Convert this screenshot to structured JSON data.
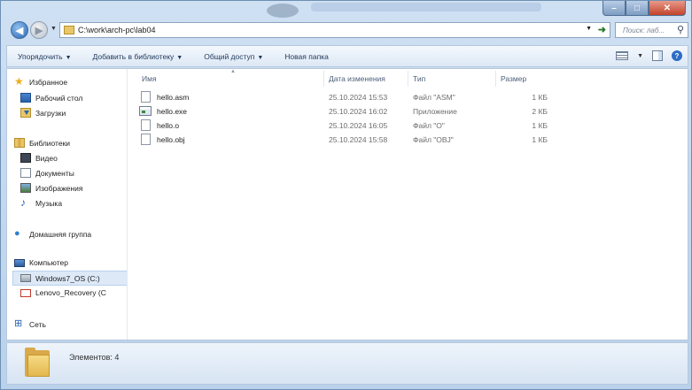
{
  "window": {
    "buttons": {
      "minimize": "–",
      "maximize": "□",
      "close": "✕"
    }
  },
  "address": {
    "path": "C:\\work\\arch-pc\\lab04",
    "search_placeholder": "Поиск: лаб..."
  },
  "toolbar": {
    "organize": "Упорядочить",
    "add_to_library": "Добавить в библиотеку",
    "share": "Общий доступ",
    "new_folder": "Новая папка"
  },
  "nav": {
    "favorites": "Избранное",
    "desktop": "Рабочий стол",
    "downloads": "Загрузки",
    "libraries": "Библиотеки",
    "video": "Видео",
    "documents": "Документы",
    "pictures": "Изображения",
    "music": "Музыка",
    "homegroup": "Домашняя группа",
    "computer": "Компьютер",
    "drive_c": "Windows7_OS (C:)",
    "drive_recovery": "Lenovo_Recovery (C",
    "network": "Сеть"
  },
  "columns": {
    "name": "Имя",
    "date": "Дата изменения",
    "type": "Тип",
    "size": "Размер"
  },
  "files": [
    {
      "name": "hello.asm",
      "date": "25.10.2024 15:53",
      "type": "Файл \"ASM\"",
      "size": "1 КБ",
      "icon": "document-icon"
    },
    {
      "name": "hello.exe",
      "date": "25.10.2024 16:02",
      "type": "Приложение",
      "size": "2 КБ",
      "icon": "application-icon"
    },
    {
      "name": "hello.o",
      "date": "25.10.2024 16:05",
      "type": "Файл \"O\"",
      "size": "1 КБ",
      "icon": "document-icon"
    },
    {
      "name": "hello.obj",
      "date": "25.10.2024 15:58",
      "type": "Файл \"OBJ\"",
      "size": "1 КБ",
      "icon": "document-icon"
    }
  ],
  "status": {
    "items_count": "Элементов: 4"
  }
}
